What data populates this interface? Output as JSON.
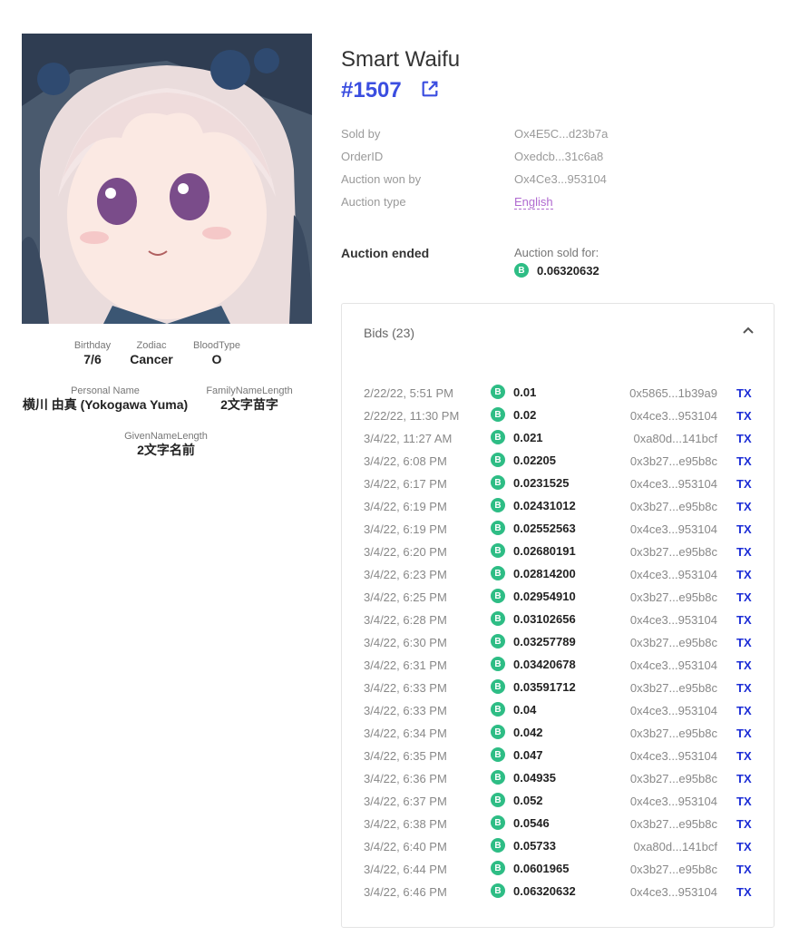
{
  "nft": {
    "name": "Smart Waifu",
    "token_id": "#1507"
  },
  "attributes": {
    "birthday": {
      "label": "Birthday",
      "value": "7/6"
    },
    "zodiac": {
      "label": "Zodiac",
      "value": "Cancer"
    },
    "blood_type": {
      "label": "BloodType",
      "value": "O"
    },
    "personal_name": {
      "label": "Personal Name",
      "value": "横川 由真 (Yokogawa Yuma)"
    },
    "family_name_length": {
      "label": "FamilyNameLength",
      "value": "2文字苗字"
    },
    "given_name_length": {
      "label": "GivenNameLength",
      "value": "2文字名前"
    }
  },
  "details": {
    "sold_by": {
      "label": "Sold by",
      "value": "Ox4E5C...d23b7a"
    },
    "order_id": {
      "label": "OrderID",
      "value": "Oxedcb...31c6a8"
    },
    "auction_won_by": {
      "label": "Auction won by",
      "value": "Ox4Ce3...953104"
    },
    "auction_type": {
      "label": "Auction type",
      "value": "English"
    }
  },
  "auction": {
    "status": "Auction ended",
    "sold_for_label": "Auction sold for:",
    "sold_for": "0.06320632",
    "coin_symbol": "B"
  },
  "bids": {
    "header": "Bids (23)",
    "tx_label": "TX",
    "rows": [
      {
        "date": "2/22/22, 5:51 PM",
        "amount": "0.01",
        "address": "0x5865...1b39a9"
      },
      {
        "date": "2/22/22, 11:30 PM",
        "amount": "0.02",
        "address": "0x4ce3...953104"
      },
      {
        "date": "3/4/22, 11:27 AM",
        "amount": "0.021",
        "address": "0xa80d...141bcf"
      },
      {
        "date": "3/4/22, 6:08 PM",
        "amount": "0.02205",
        "address": "0x3b27...e95b8c"
      },
      {
        "date": "3/4/22, 6:17 PM",
        "amount": "0.0231525",
        "address": "0x4ce3...953104"
      },
      {
        "date": "3/4/22, 6:19 PM",
        "amount": "0.02431012",
        "address": "0x3b27...e95b8c"
      },
      {
        "date": "3/4/22, 6:19 PM",
        "amount": "0.02552563",
        "address": "0x4ce3...953104"
      },
      {
        "date": "3/4/22, 6:20 PM",
        "amount": "0.02680191",
        "address": "0x3b27...e95b8c"
      },
      {
        "date": "3/4/22, 6:23 PM",
        "amount": "0.02814200",
        "address": "0x4ce3...953104"
      },
      {
        "date": "3/4/22, 6:25 PM",
        "amount": "0.02954910",
        "address": "0x3b27...e95b8c"
      },
      {
        "date": "3/4/22, 6:28 PM",
        "amount": "0.03102656",
        "address": "0x4ce3...953104"
      },
      {
        "date": "3/4/22, 6:30 PM",
        "amount": "0.03257789",
        "address": "0x3b27...e95b8c"
      },
      {
        "date": "3/4/22, 6:31 PM",
        "amount": "0.03420678",
        "address": "0x4ce3...953104"
      },
      {
        "date": "3/4/22, 6:33 PM",
        "amount": "0.03591712",
        "address": "0x3b27...e95b8c"
      },
      {
        "date": "3/4/22, 6:33 PM",
        "amount": "0.04",
        "address": "0x4ce3...953104"
      },
      {
        "date": "3/4/22, 6:34 PM",
        "amount": "0.042",
        "address": "0x3b27...e95b8c"
      },
      {
        "date": "3/4/22, 6:35 PM",
        "amount": "0.047",
        "address": "0x4ce3...953104"
      },
      {
        "date": "3/4/22, 6:36 PM",
        "amount": "0.04935",
        "address": "0x3b27...e95b8c"
      },
      {
        "date": "3/4/22, 6:37 PM",
        "amount": "0.052",
        "address": "0x4ce3...953104"
      },
      {
        "date": "3/4/22, 6:38 PM",
        "amount": "0.0546",
        "address": "0x3b27...e95b8c"
      },
      {
        "date": "3/4/22, 6:40 PM",
        "amount": "0.05733",
        "address": "0xa80d...141bcf"
      },
      {
        "date": "3/4/22, 6:44 PM",
        "amount": "0.0601965",
        "address": "0x3b27...e95b8c"
      },
      {
        "date": "3/4/22, 6:46 PM",
        "amount": "0.06320632",
        "address": "0x4ce3...953104"
      }
    ]
  },
  "colors": {
    "accent": "#3b4ee0",
    "coin": "#2ebd85",
    "link_purple": "#b06ad0",
    "tx_blue": "#1c2dd6"
  }
}
